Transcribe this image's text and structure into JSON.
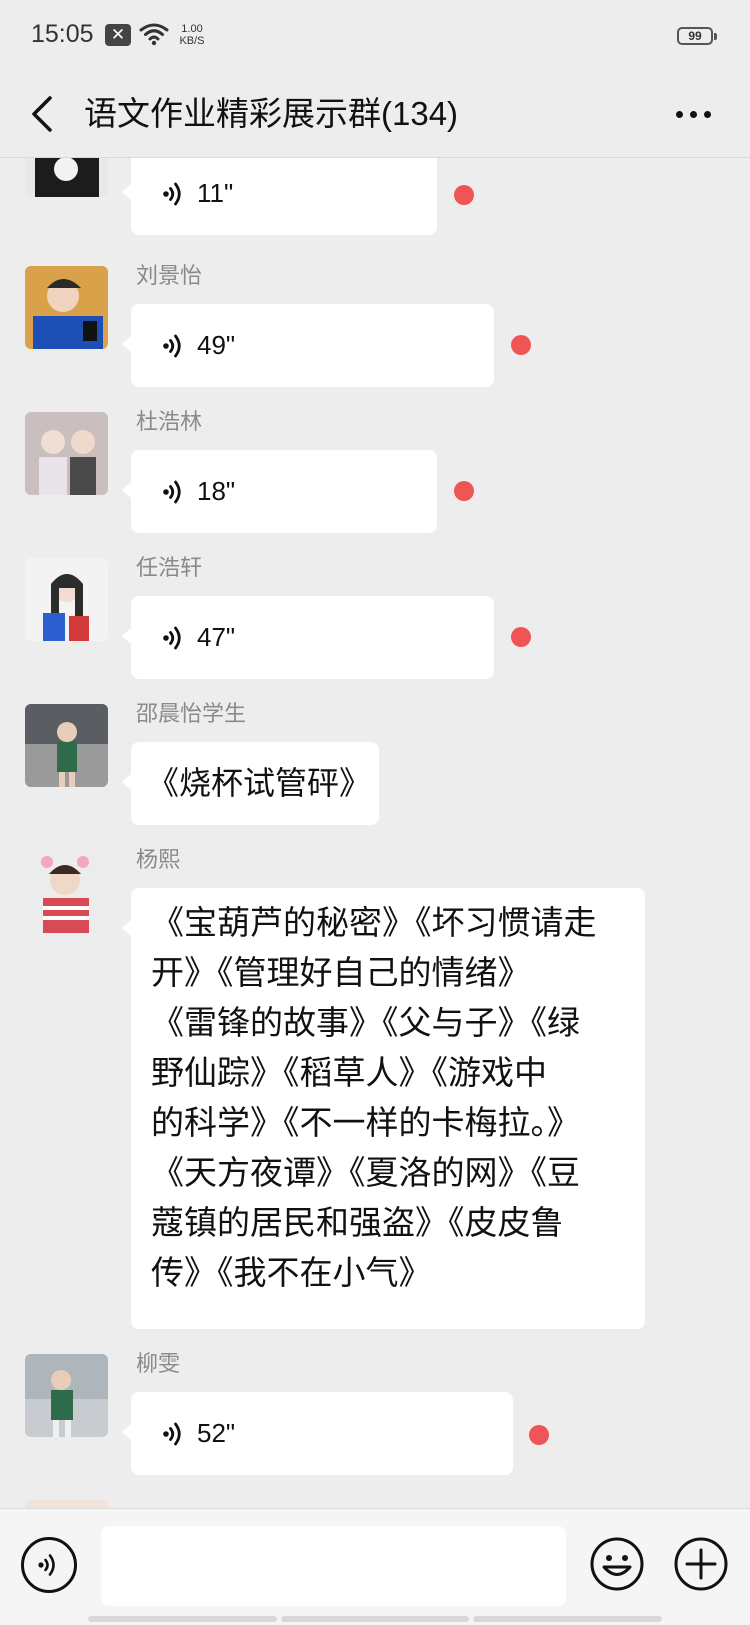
{
  "status_bar": {
    "time": "15:05",
    "notification_icon": "x-notification-icon",
    "net_speed_value": "1.00",
    "net_speed_unit": "KB/S",
    "battery": "99"
  },
  "header": {
    "title": "语文作业精彩展示群(134)",
    "back_icon": "chevron-left-icon",
    "more_icon": "more-dots-icon"
  },
  "colors": {
    "background": "#ededed",
    "bubble": "#ffffff",
    "unread_dot": "#f05555",
    "sender_name": "#8a8a8a"
  },
  "messages": [
    {
      "sender": "",
      "type": "voice",
      "duration": "11\"",
      "unread": true
    },
    {
      "sender": "刘景怡",
      "type": "voice",
      "duration": "49\"",
      "unread": true
    },
    {
      "sender": "杜浩林",
      "type": "voice",
      "duration": "18\"",
      "unread": true
    },
    {
      "sender": "任浩轩",
      "type": "voice",
      "duration": "47\"",
      "unread": true
    },
    {
      "sender": "邵晨怡学生",
      "type": "text",
      "text": "《烧杯试管砰》"
    },
    {
      "sender": "杨熙",
      "type": "text",
      "lines": [
        "《宝葫芦的秘密》《坏习惯请走",
        "开》《管理好自己的情绪》",
        "《雷锋的故事》《父与子》《绿",
        "野仙踪》《稻草人》《游戏中",
        "的科学》《不一样的卡梅拉。》",
        "《天方夜谭》《夏洛的网》《豆",
        "蔻镇的居民和强盗》《皮皮鲁",
        "传》《我不在小气》"
      ]
    },
    {
      "sender": "柳雯",
      "type": "voice",
      "duration": "52\"",
      "unread": true
    }
  ],
  "bottom_bar": {
    "voice_icon": "voice-input-icon",
    "input_value": "",
    "emoji_icon": "emoji-icon",
    "plus_icon": "plus-icon"
  }
}
